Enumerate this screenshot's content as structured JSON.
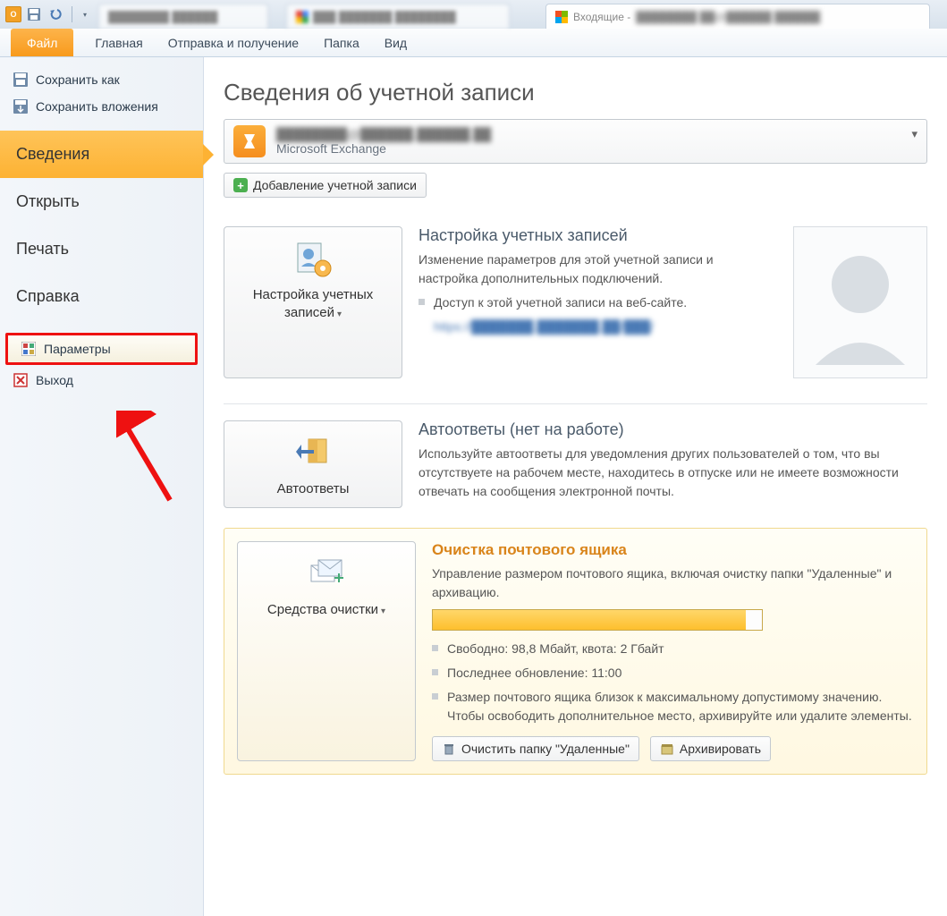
{
  "titlebar": {
    "inbox_label": "Входящие -"
  },
  "ribbon": {
    "file": "Файл",
    "home": "Главная",
    "send_receive": "Отправка и получение",
    "folder": "Папка",
    "view": "Вид"
  },
  "sidebar": {
    "save_as": "Сохранить как",
    "save_attachments": "Сохранить вложения",
    "info": "Сведения",
    "open": "Открыть",
    "print": "Печать",
    "help": "Справка",
    "options": "Параметры",
    "exit": "Выход"
  },
  "content": {
    "page_title": "Сведения об учетной записи",
    "account_type": "Microsoft Exchange",
    "add_account": "Добавление учетной записи",
    "sections": {
      "settings": {
        "btn": "Настройка учетных записей",
        "title": "Настройка учетных записей",
        "desc": "Изменение параметров для этой учетной записи и настройка дополнительных подключений.",
        "bullet1": "Доступ к этой учетной записи на веб-сайте."
      },
      "autoreply": {
        "btn": "Автоответы",
        "title": "Автоответы (нет на работе)",
        "desc": "Используйте автоответы для уведомления других пользователей о том, что вы отсутствуете на рабочем месте, находитесь в отпуске или не имеете возможности отвечать на сообщения электронной почты."
      },
      "cleanup": {
        "btn": "Средства очистки",
        "title": "Очистка почтового ящика",
        "desc": "Управление размером почтового ящика, включая очистку папки \"Удаленные\" и архивацию.",
        "quota_percent": 95,
        "b1": "Свободно: 98,8 Мбайт, квота: 2 Гбайт",
        "b2": "Последнее обновление: 11:00",
        "b3": "Размер почтового ящика близок к максимальному допустимому значению. Чтобы освободить дополнительное место, архивируйте или удалите элементы.",
        "empty_deleted": "Очистить папку \"Удаленные\"",
        "archive": "Архивировать"
      }
    }
  }
}
